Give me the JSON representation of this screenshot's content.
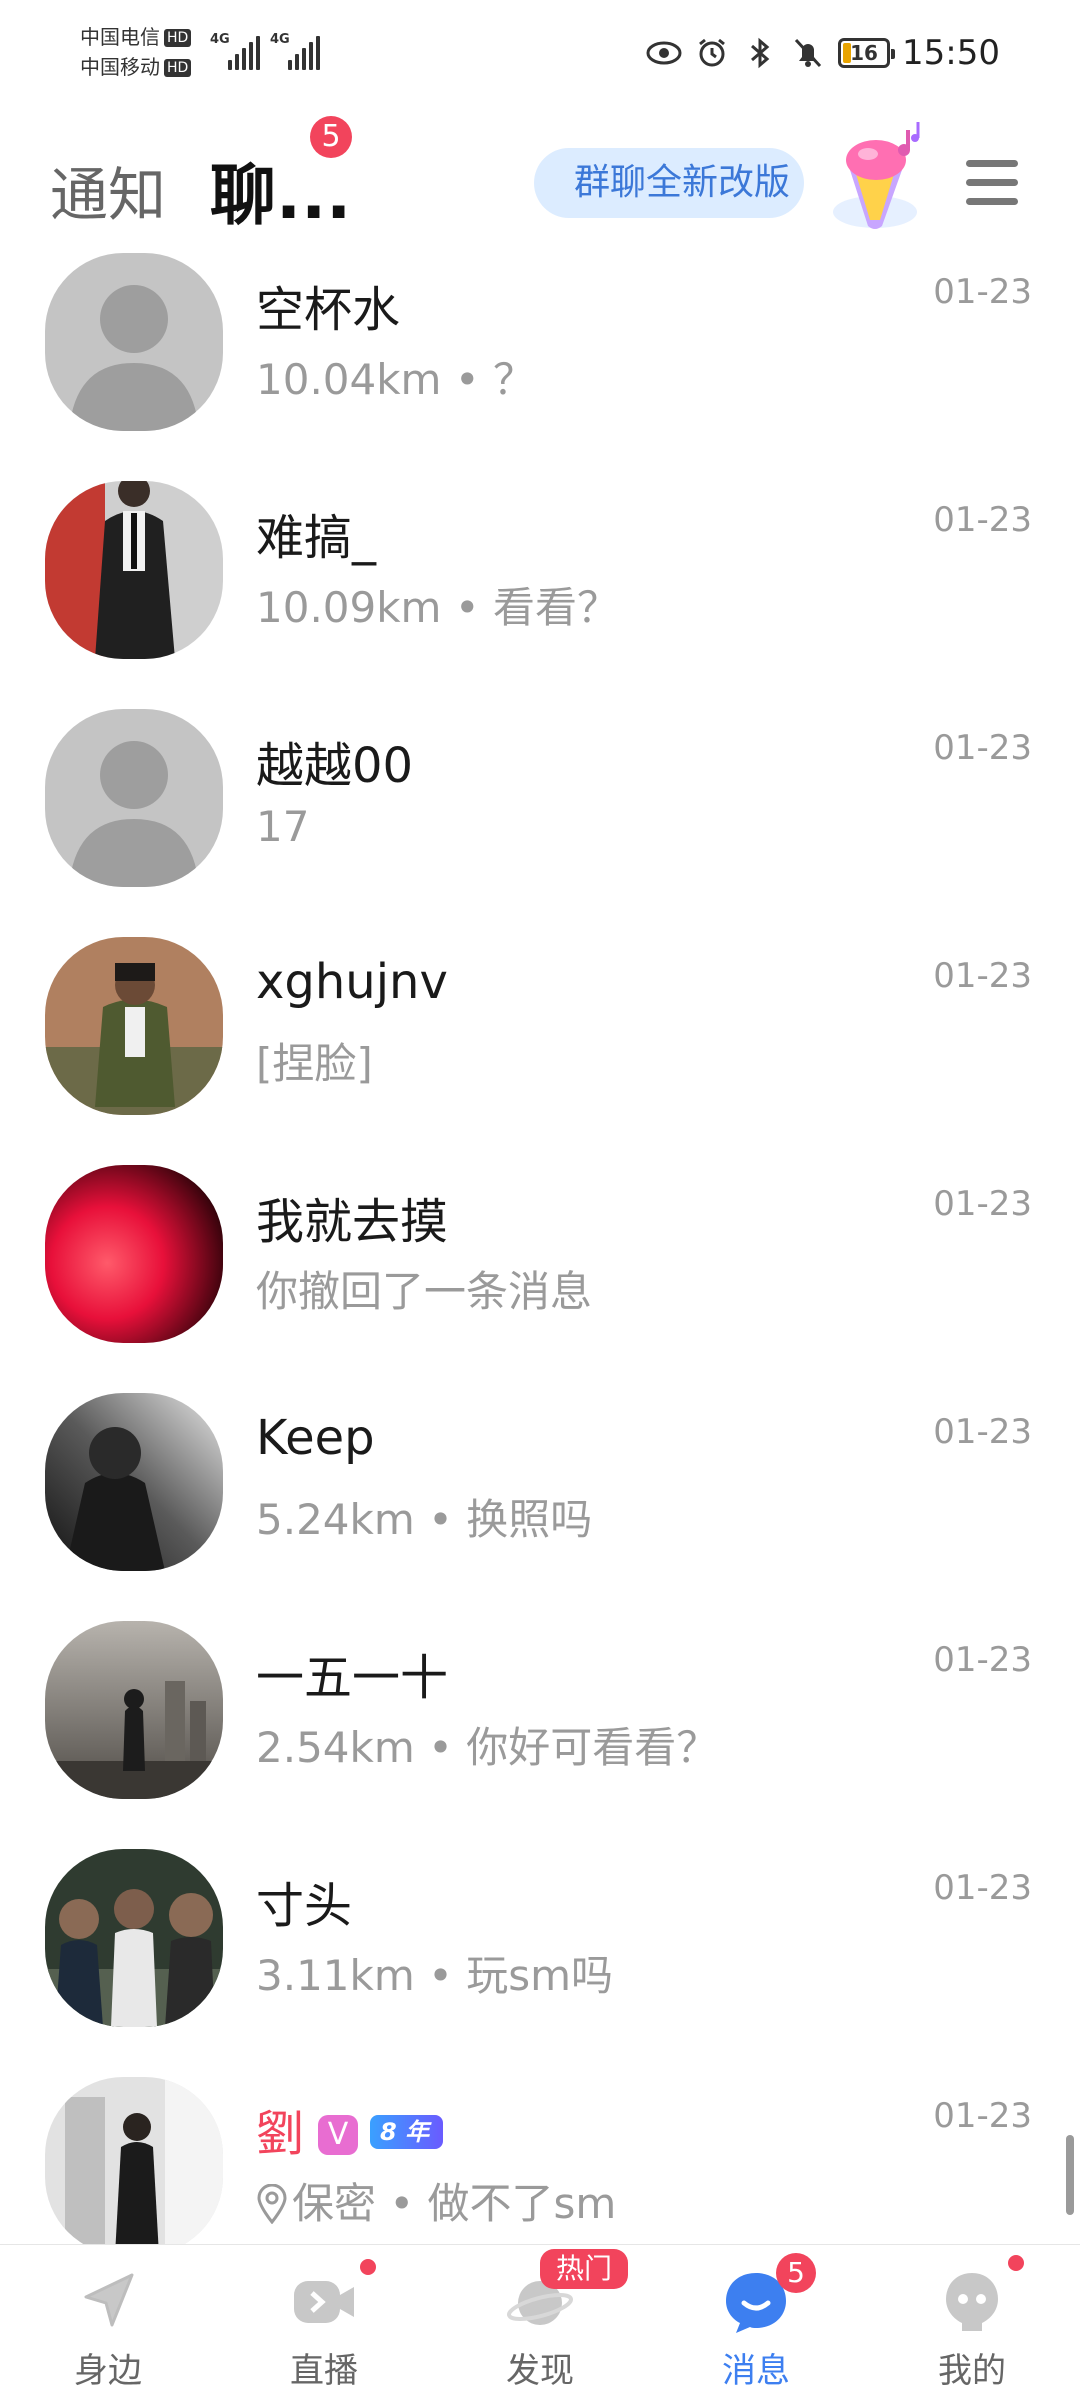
{
  "status_bar": {
    "carrier_1": "中国电信",
    "carrier_2": "中国移动",
    "hd_1": "HD",
    "hd_2": "HD",
    "network_1": "4G",
    "network_2": "4G",
    "battery": "16",
    "time": "15:50",
    "icons": [
      "eye-icon",
      "alarm-icon",
      "bluetooth-icon",
      "mute-icon"
    ]
  },
  "header": {
    "tab_notice": "通知",
    "tab_chat": "聊...",
    "chat_badge": "5",
    "promo_label": "群聊全新改版"
  },
  "chats": [
    {
      "name": "空杯水",
      "preview": "10.04km • ？",
      "time": "01-23",
      "avatar": "default"
    },
    {
      "name": "难搞_",
      "preview": "10.09km • 看看？",
      "time": "01-23",
      "avatar": "photo-suit"
    },
    {
      "name": "越越00",
      "preview": "17",
      "time": "01-23",
      "avatar": "default"
    },
    {
      "name": "xghujnv",
      "preview": "[捏脸]",
      "time": "01-23",
      "avatar": "photo-green"
    },
    {
      "name": "我就去摸",
      "preview": "你撤回了一条消息",
      "time": "01-23",
      "avatar": "photo-red"
    },
    {
      "name": "Keep",
      "preview": "5.24km • 换照吗",
      "time": "01-23",
      "avatar": "photo-dark"
    },
    {
      "name": "一五一十",
      "preview": "2.54km • 你好可看看？",
      "time": "01-23",
      "avatar": "photo-city"
    },
    {
      "name": "寸头",
      "preview": "3.11km • 玩sm吗",
      "time": "01-23",
      "avatar": "photo-group"
    },
    {
      "name": "劉",
      "preview": "保密 • 做不了sm",
      "time": "01-23",
      "avatar": "photo-mirror",
      "v_badge": "V",
      "year_badge": "8 年"
    }
  ],
  "bottom_nav": [
    {
      "label": "身边",
      "icon": "location-arrow-icon",
      "active": false
    },
    {
      "label": "直播",
      "icon": "video-icon",
      "active": false,
      "dot": true
    },
    {
      "label": "发现",
      "icon": "planet-icon",
      "active": false,
      "badge": "热门"
    },
    {
      "label": "消息",
      "icon": "message-icon",
      "active": true,
      "badge": "5"
    },
    {
      "label": "我的",
      "icon": "profile-icon",
      "active": false,
      "dot": true
    }
  ],
  "colors": {
    "accent": "#3d7ff0",
    "badge": "#f2445c",
    "name_pink": "#f2445c"
  }
}
